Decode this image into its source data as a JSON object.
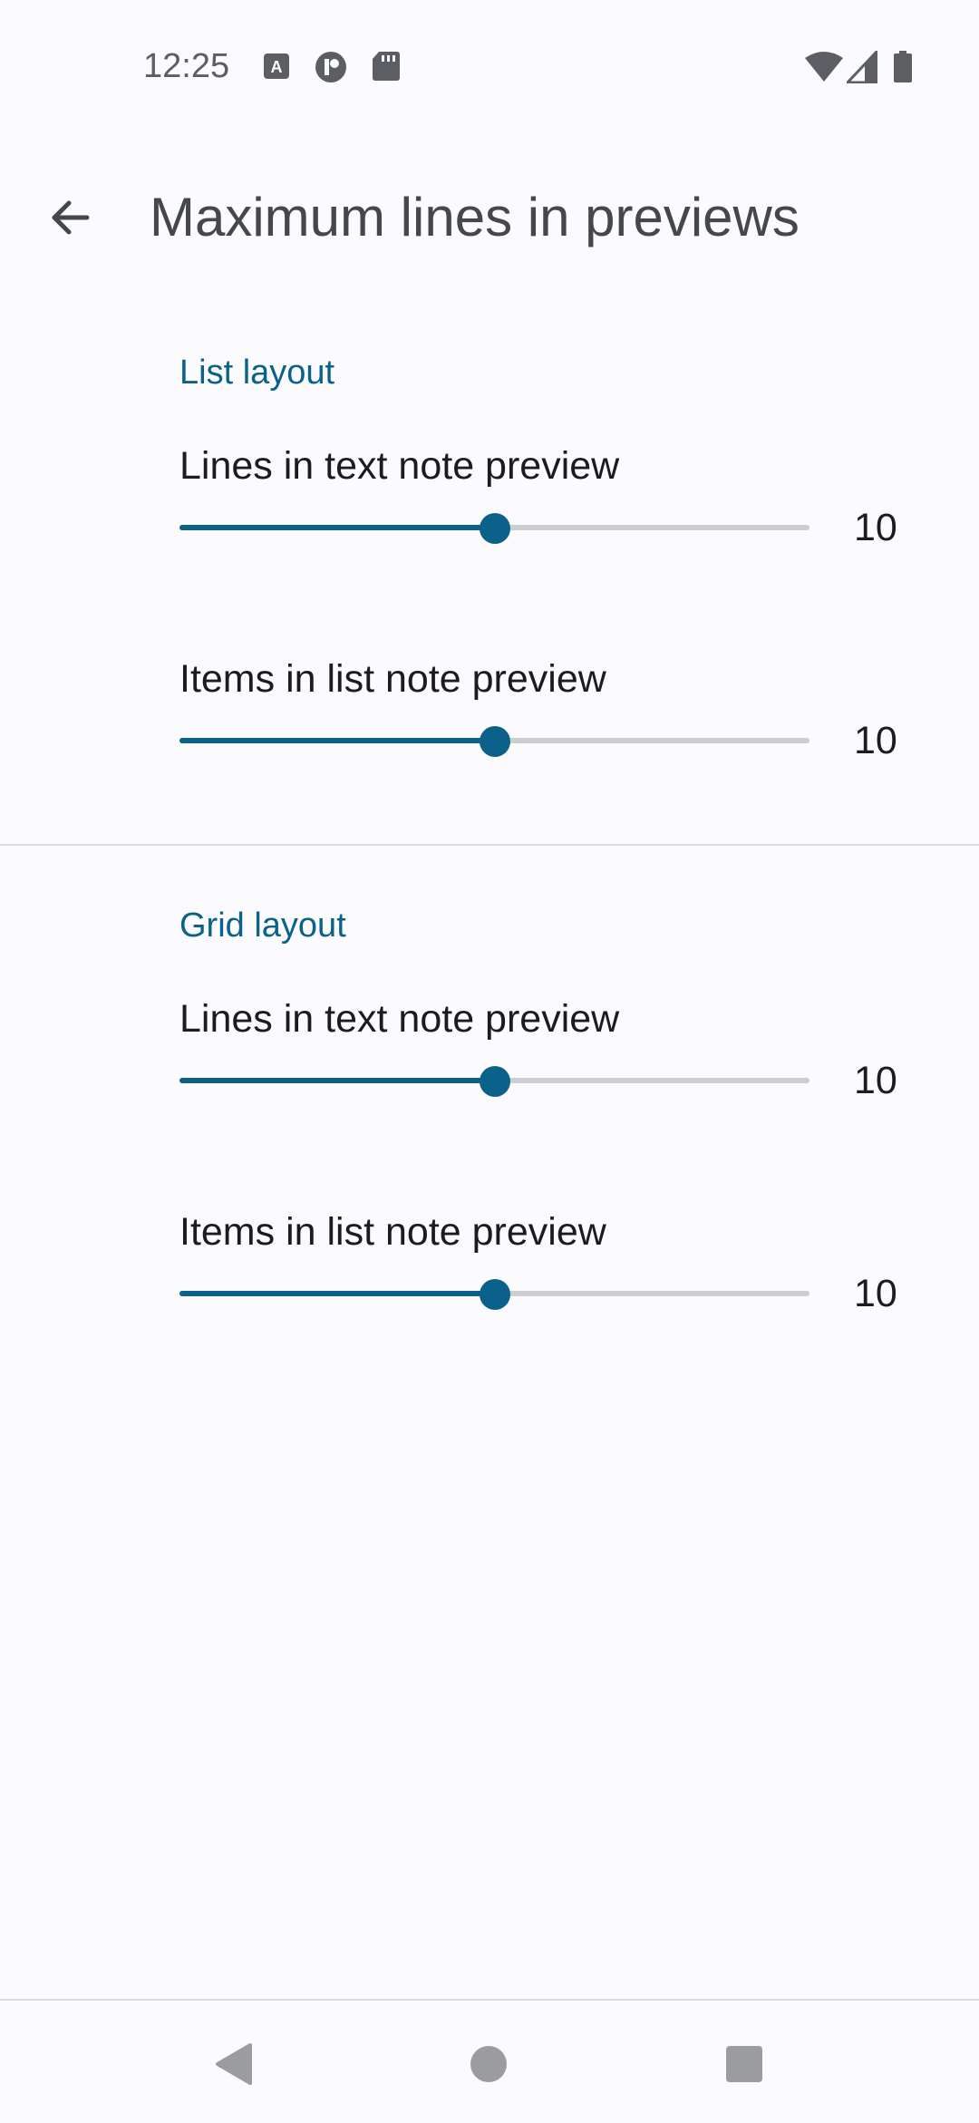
{
  "status_bar": {
    "time": "12:25",
    "left_icons": [
      "a-notification-icon",
      "circle-notification-icon",
      "sd-card-icon"
    ],
    "right_icons": [
      "wifi-icon",
      "signal-icon",
      "battery-icon"
    ]
  },
  "app_bar": {
    "back_icon": "arrow-back-icon",
    "title": "Maximum lines in previews"
  },
  "sections": [
    {
      "header": "List layout",
      "prefs": [
        {
          "title": "Lines in text note preview",
          "value": "10",
          "slider_fraction": 0.5
        },
        {
          "title": "Items in list note preview",
          "value": "10",
          "slider_fraction": 0.5
        }
      ]
    },
    {
      "header": "Grid layout",
      "prefs": [
        {
          "title": "Lines in text note preview",
          "value": "10",
          "slider_fraction": 0.5
        },
        {
          "title": "Items in list note preview",
          "value": "10",
          "slider_fraction": 0.5
        }
      ]
    }
  ],
  "colors": {
    "accent": "#0b6189",
    "background": "#fbfbfe",
    "track_inactive": "#cbcdd1"
  },
  "nav_bar": {
    "icons": [
      "back-triangle-icon",
      "home-circle-icon",
      "recents-square-icon"
    ]
  }
}
